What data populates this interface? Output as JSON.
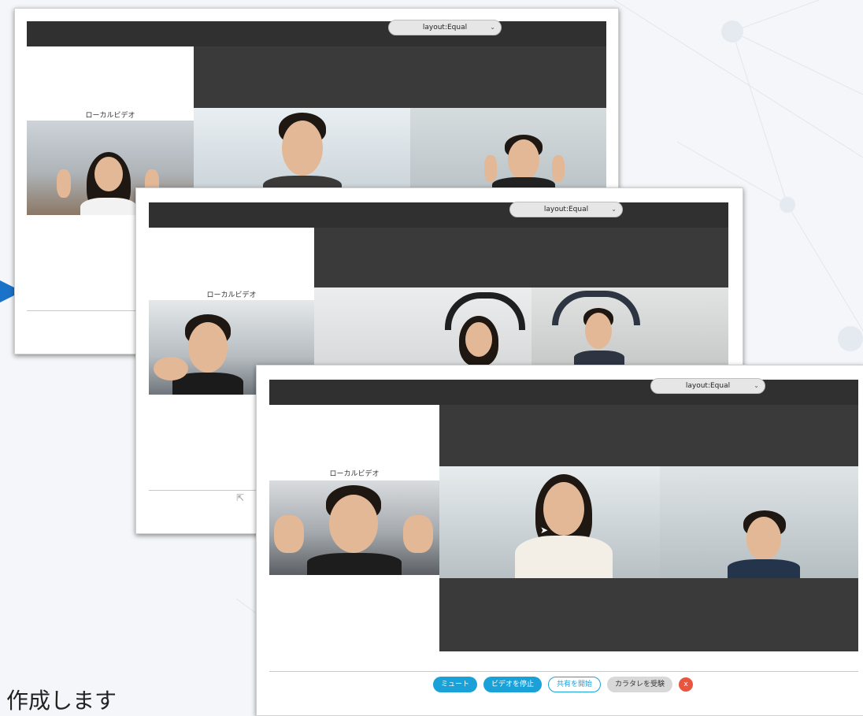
{
  "caption": "作成します",
  "windows": [
    {
      "layout_select": "layout:Equal",
      "local_video_label": "ローカルビデオ"
    },
    {
      "layout_select": "layout:Equal",
      "local_video_label": "ローカルビデオ"
    },
    {
      "layout_select": "layout:Equal",
      "local_video_label": "ローカルビデオ",
      "controls": {
        "mute": "ミュート",
        "stop_video": "ビデオを停止",
        "start_share": "共有を開始",
        "receive_color": "カラタレを受験",
        "close": "x"
      }
    }
  ],
  "colors": {
    "accent": "#1aa1d8",
    "close": "#e8563f",
    "arrow": "#1a73c9",
    "topbar": "#303030"
  }
}
